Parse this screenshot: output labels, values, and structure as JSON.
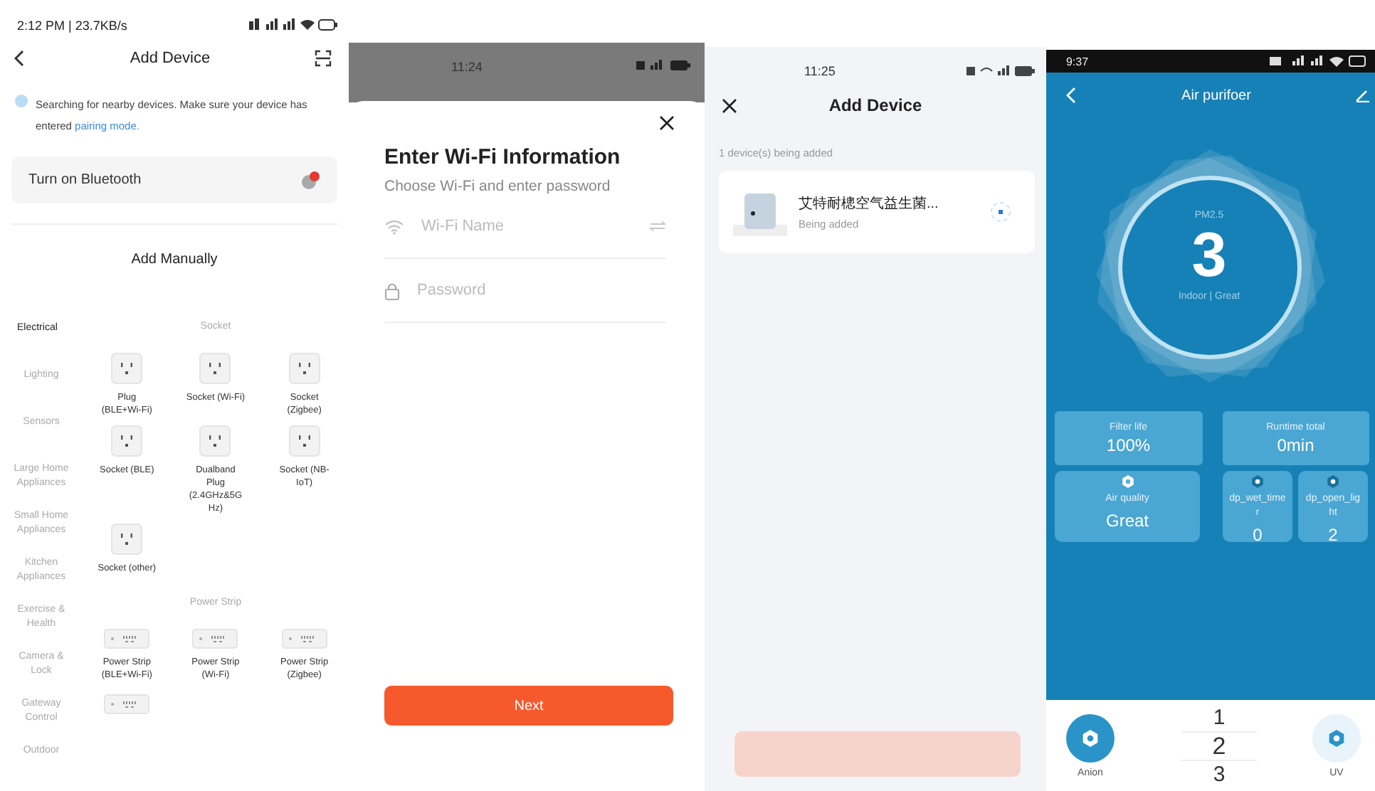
{
  "add_device": {
    "status_time": "2:12 PM | 23.7KB/s",
    "title": "Add Device",
    "notice": {
      "text": "Searching for nearby devices. Make sure your device has entered ",
      "link": "pairing mode."
    },
    "bluetooth": {
      "label": "Turn on Bluetooth",
      "alert": true
    },
    "section_title": "Add Manually",
    "categories": [
      {
        "label": "Electrical",
        "selected": true
      },
      {
        "label": "Lighting",
        "selected": false
      },
      {
        "label": "Sensors",
        "selected": false
      },
      {
        "label": "Large Home Appliances",
        "selected": false
      },
      {
        "label": "Small Home Appliances",
        "selected": false
      },
      {
        "label": "Kitchen Appliances",
        "selected": false
      },
      {
        "label": "Exercise & Health",
        "selected": false
      },
      {
        "label": "Camera & Lock",
        "selected": false
      },
      {
        "label": "Gateway Control",
        "selected": false
      },
      {
        "label": "Outdoor",
        "selected": false
      }
    ],
    "groups": [
      {
        "title": "Socket",
        "items": [
          {
            "kind": "socket",
            "label": "Plug (BLE+Wi-Fi)"
          },
          {
            "kind": "socket",
            "label": "Socket (Wi-Fi)"
          },
          {
            "kind": "socket",
            "label": "Socket (Zigbee)"
          },
          {
            "kind": "socket",
            "label": "Socket (BLE)"
          },
          {
            "kind": "socket",
            "label": "Dualband Plug (2.4GHz&5G Hz)"
          },
          {
            "kind": "socket",
            "label": "Socket (NB-IoT)"
          },
          {
            "kind": "socket",
            "label": "Socket (other)"
          }
        ]
      },
      {
        "title": "Power Strip",
        "items": [
          {
            "kind": "strip",
            "label": "Power Strip (BLE+Wi-Fi)"
          },
          {
            "kind": "strip",
            "label": "Power Strip (Wi-Fi)"
          },
          {
            "kind": "strip",
            "label": "Power Strip (Zigbee)"
          },
          {
            "kind": "strip"
          }
        ]
      }
    ]
  },
  "wifi_form": {
    "status_time": "11:24",
    "title": "Enter Wi-Fi Information",
    "subtitle": "Choose Wi-Fi and enter password",
    "fields": [
      {
        "kind": "wifi",
        "placeholder": "Wi-Fi Name"
      },
      {
        "kind": "password",
        "placeholder": "Password"
      }
    ],
    "button": "Next"
  },
  "adding": {
    "status_time": "11:25",
    "title": "Add Device",
    "count_text": "1 device(s) being added",
    "device": {
      "name": "艾特耐樬空气益生菌...",
      "status": "Being added"
    },
    "button": {
      "disabled": true
    }
  },
  "purifier": {
    "status_time": "9:37",
    "title": "Air purifoer",
    "reading": {
      "label": "PM2.5",
      "value": "3",
      "caption": "Indoor | Great"
    },
    "stats": [
      {
        "label": "Filter life",
        "value": "100%"
      },
      {
        "label": "Runtime total",
        "value": "0min"
      }
    ],
    "tiles": [
      {
        "kind": "wide",
        "label": "Air quality",
        "value": "Great"
      },
      {
        "kind": "small",
        "label": "dp_wet_timer",
        "value": "0"
      },
      {
        "kind": "small",
        "label": "dp_open_light",
        "value": "2"
      }
    ],
    "modes": [
      {
        "label": "Anion",
        "on": true
      },
      {
        "label": "UV",
        "on": false
      }
    ],
    "picker": [
      {
        "label": "1",
        "selected": false
      },
      {
        "label": "2",
        "selected": true
      },
      {
        "label": "3",
        "selected": false
      }
    ]
  }
}
